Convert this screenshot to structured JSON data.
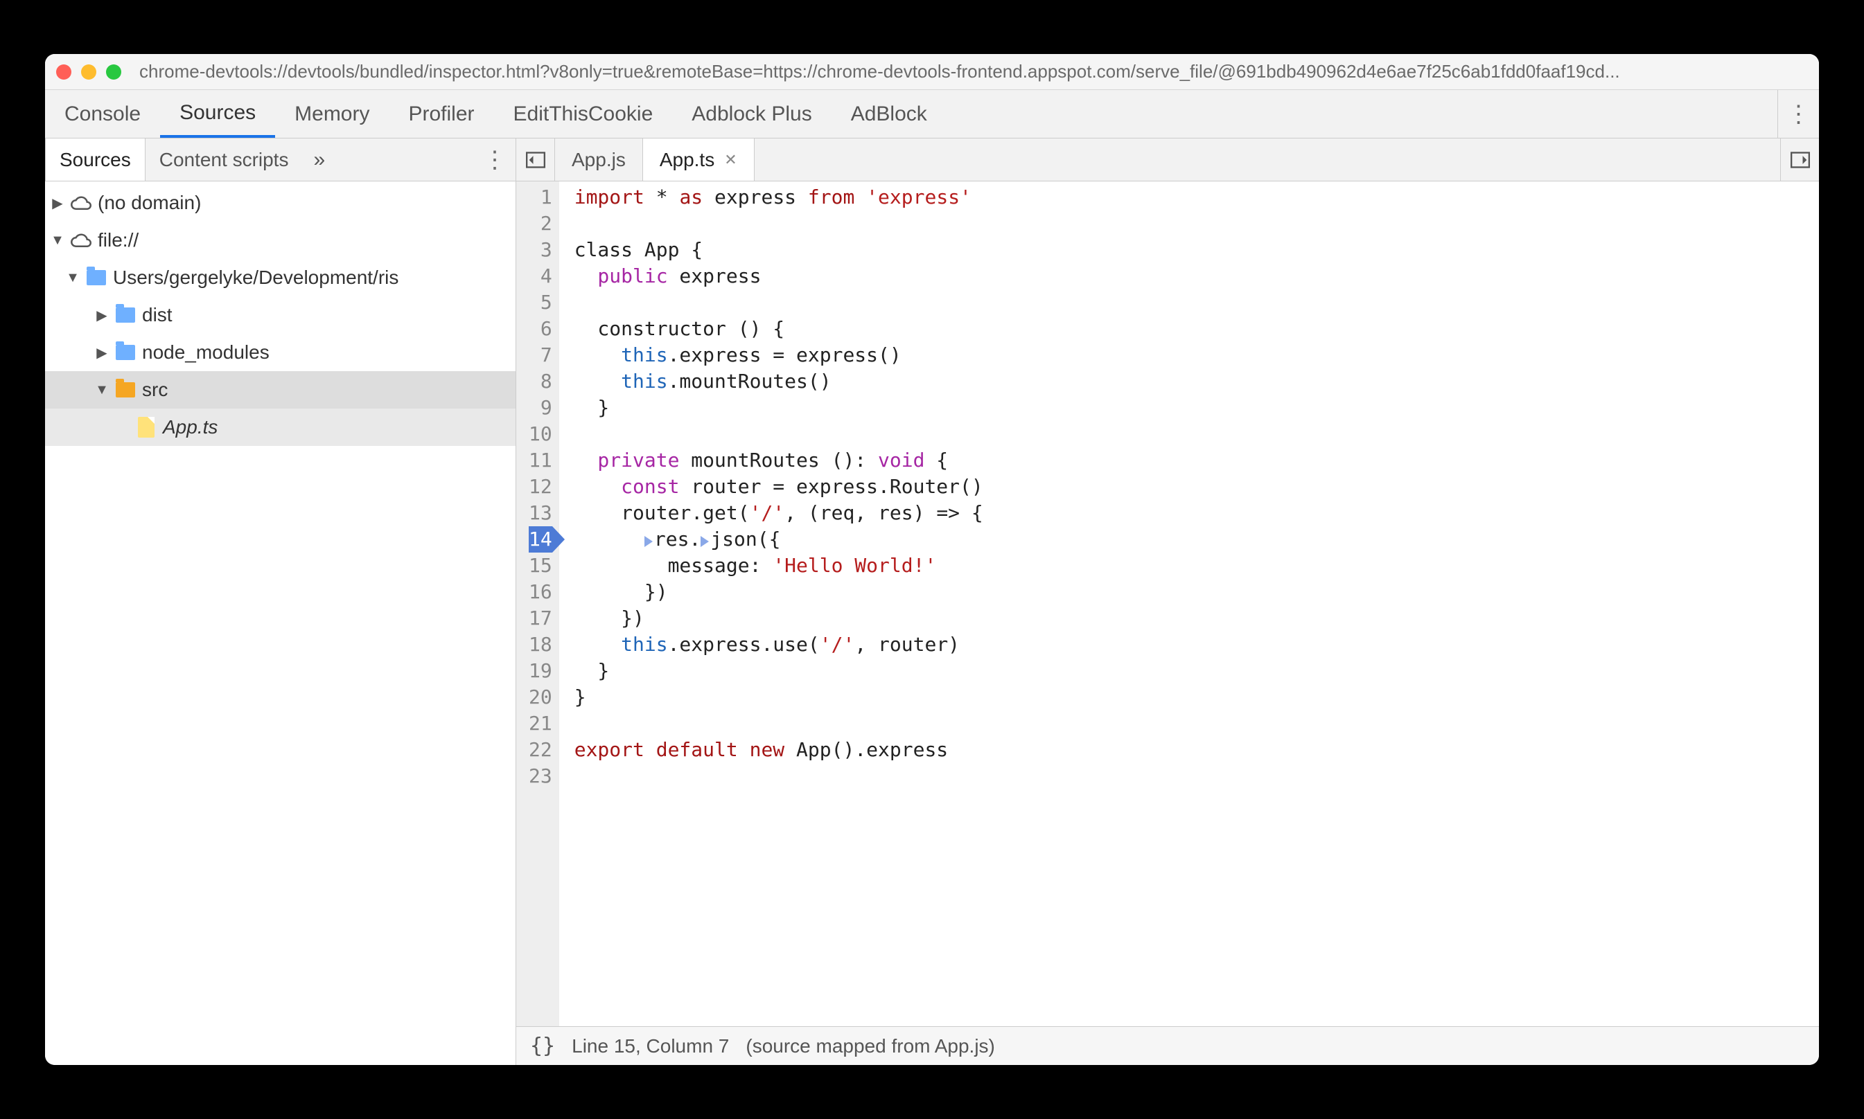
{
  "titlebar": {
    "url": "chrome-devtools://devtools/bundled/inspector.html?v8only=true&remoteBase=https://chrome-devtools-frontend.appspot.com/serve_file/@691bdb490962d4e6ae7f25c6ab1fdd0faaf19cd..."
  },
  "panel_tabs": [
    "Console",
    "Sources",
    "Memory",
    "Profiler",
    "EditThisCookie",
    "Adblock Plus",
    "AdBlock"
  ],
  "panel_active_index": 1,
  "sidebar": {
    "tabs": [
      "Sources",
      "Content scripts"
    ],
    "active_index": 0,
    "tree": {
      "no_domain": "(no domain)",
      "file_scheme": "file://",
      "path": "Users/gergelyke/Development/ris",
      "dist": "dist",
      "node_modules": "node_modules",
      "src": "src",
      "app_ts": "App.ts"
    }
  },
  "editor": {
    "tabs": [
      {
        "name": "App.js",
        "active": false,
        "closeable": false
      },
      {
        "name": "App.ts",
        "active": true,
        "closeable": true
      }
    ],
    "breakpoint_line": 14,
    "line_count": 23,
    "code": {
      "l1_a": "import",
      "l1_b": " * ",
      "l1_c": "as",
      "l1_d": " express ",
      "l1_e": "from",
      "l1_f": " 'express'",
      "l3": "class App {",
      "l4_a": "  public",
      "l4_b": " express",
      "l6": "  constructor () {",
      "l7_a": "    this",
      "l7_b": ".express = express()",
      "l8_a": "    this",
      "l8_b": ".mountRoutes()",
      "l9": "  }",
      "l11_a": "  private",
      "l11_b": " mountRoutes (): ",
      "l11_c": "void",
      "l11_d": " {",
      "l12_a": "    const",
      "l12_b": " router = express.Router()",
      "l13_a": "    router.get(",
      "l13_b": "'/'",
      "l13_c": ", (req, res) => {",
      "l14_a": "      ",
      "l14_b": "res.",
      "l14_c": "json({",
      "l15_a": "        message: ",
      "l15_b": "'Hello World!'",
      "l16": "      })",
      "l17": "    })",
      "l18_a": "    this",
      "l18_b": ".express.use(",
      "l18_c": "'/'",
      "l18_d": ", router)",
      "l19": "  }",
      "l20": "}",
      "l22_a": "export default new",
      "l22_b": " App().express"
    }
  },
  "status": {
    "braces": "{}",
    "cursor": "Line 15, Column 7",
    "mapped": "(source mapped from App.js)"
  }
}
